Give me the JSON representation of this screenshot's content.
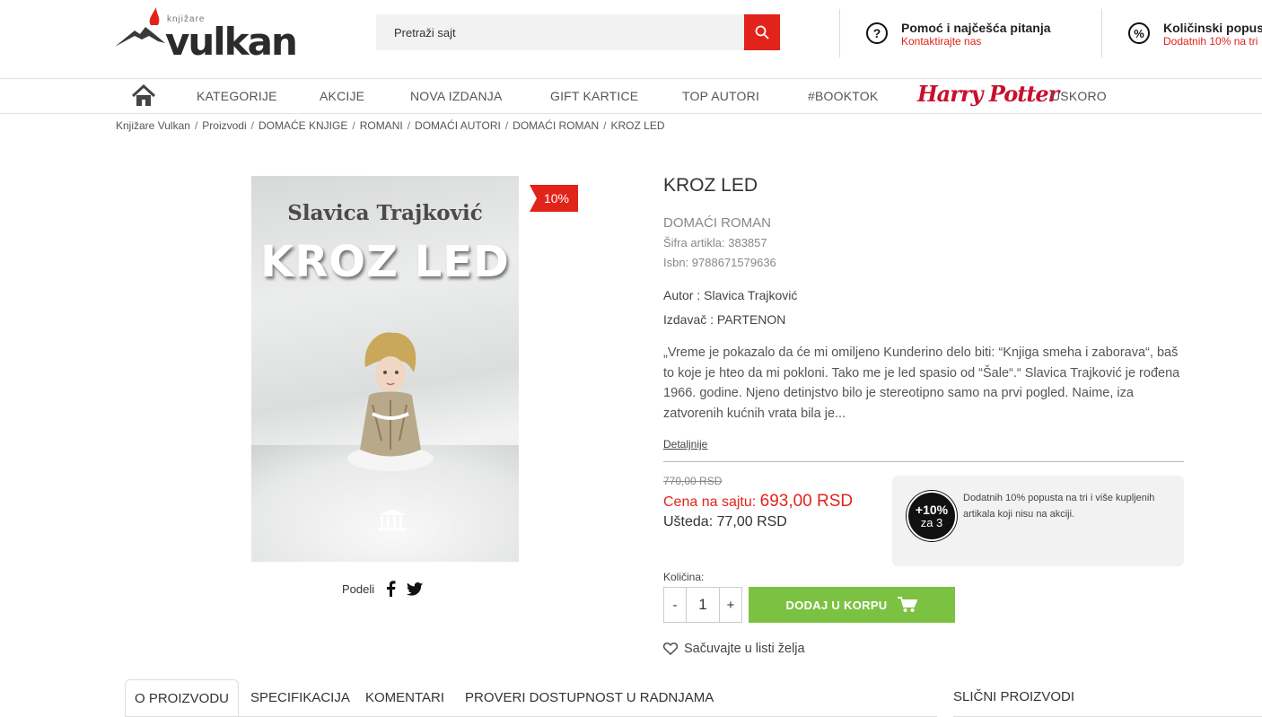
{
  "header": {
    "logo_small": "knjižare",
    "logo_big": "vulkan",
    "search_placeholder": "Pretraži sajt",
    "help_title": "Pomoć i najčešća pitanja",
    "help_sub": "Kontaktirajte nas",
    "discount_title": "Količinski popust",
    "discount_sub": "Dodatnih 10% na tri"
  },
  "nav": {
    "items": [
      "KATEGORIJE",
      "AKCIJE",
      "NOVA IZDANJA",
      "GIFT KARTICE",
      "TOP AUTORI",
      "#BOOKTOK",
      "Harry Potter",
      "USKORO"
    ]
  },
  "breadcrumb": [
    "Knjižare Vulkan",
    "Proizvodi",
    "DOMAĆE KNJIGE",
    "ROMANI",
    "DOMAĆI AUTORI",
    "DOMAĆI ROMAN",
    "KROZ LED"
  ],
  "cover": {
    "author": "Slavica Trajković",
    "title": "KROZ LED"
  },
  "badge": "10%",
  "share_label": "Podeli",
  "product": {
    "title": "KROZ LED",
    "category": "DOMAĆI ROMAN",
    "sku": "Šifra artikla: 383857",
    "isbn": "Isbn: 9788671579636",
    "author": "Autor : Slavica Trajković",
    "publisher": "Izdavač : PARTENON",
    "description": "„Vreme je pokazalo da će mi omiljeno Kunderino delo biti: “Knjiga smeha i zaborava“, baš to koje je hteo da mi pokloni. Tako me je led spasio od “Šale“.“ Slavica Trajković je rođena 1966. godine. Njeno detinjstvo bilo je stereotipno samo na prvi pogled. Naime, iza zatvorenih kućnih vrata bila je...",
    "details_link": "Detaljnije",
    "old_price": "770,00 RSD",
    "price_label": "Cena na sajtu:",
    "price": "693,00 RSD",
    "savings": "Ušteda: 77,00 RSD",
    "quantity_label": "Količina:",
    "quantity": "1",
    "minus": "-",
    "plus": "+",
    "add_to_cart": "DODAJ U KORPU",
    "wishlist": "Sačuvajte u listi želja"
  },
  "promo": {
    "circle_top": "+10%",
    "circle_bottom": "za 3",
    "text": "Dodatnih 10% popusta na tri i više kupljenih artikala koji nisu na akciji."
  },
  "tabs": [
    "O PROIZVODU",
    "SPECIFIKACIJA",
    "KOMENTARI",
    "PROVERI DOSTUPNOST U RADNJAMA"
  ],
  "similar_title": "SLIČNI PROIZVODI",
  "colors": {
    "accent_red": "#e2231a",
    "cart_green": "#7cc242"
  }
}
